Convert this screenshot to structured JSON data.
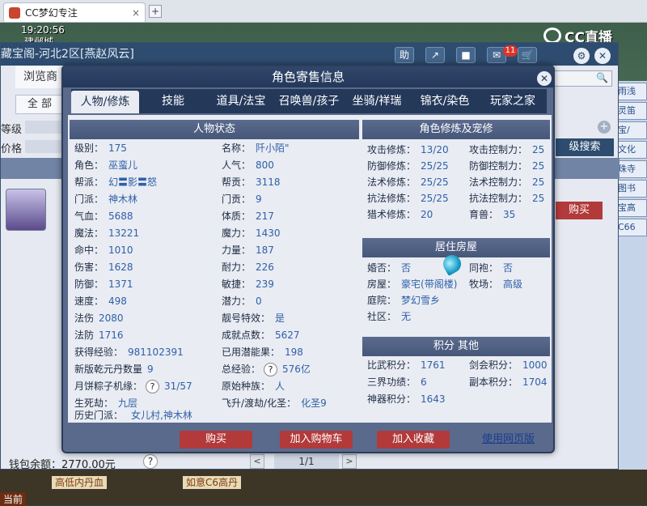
{
  "browser": {
    "tab_title": "CC梦幻专注",
    "close_glyph": "×",
    "new_tab_glyph": "+"
  },
  "hud": {
    "time": "19:20:56",
    "location": "建邺城",
    "cc_brand": "CC直播"
  },
  "back_window": {
    "title": "藏宝阁-河北2区[燕赵风云]",
    "toolbar": {
      "help": "助",
      "share_icon": "share-icon",
      "stop": "■",
      "message_badge": "11",
      "cart_icon": "cart-icon",
      "settings": "⚙",
      "close": "✕"
    },
    "nav_browse": "浏览商",
    "all_filter": "全 部",
    "level_label": "等级",
    "price_label": "价格",
    "plus": "+",
    "advanced_search": "级搜索",
    "buy_small": "购买",
    "wallet_text": "钱包余额：2770.00元",
    "question": "?",
    "pager": {
      "prev": "<",
      "text": "1/1",
      "next": ">"
    }
  },
  "right_strip": [
    "雨浅",
    "灵笛",
    "宝/",
    "文化",
    "珠寺",
    "图书",
    "宝高",
    "C66"
  ],
  "bottom_strip": {
    "items": [
      "高低内丹血",
      "如意C6高丹"
    ],
    "current": "当前"
  },
  "modal": {
    "title": "角色寄售信息",
    "close": "✕",
    "tabs": [
      {
        "label": "人物/修炼",
        "active": true
      },
      {
        "label": "技能",
        "active": false
      },
      {
        "label": "道具/法宝",
        "active": false
      },
      {
        "label": "召唤兽/孩子",
        "active": false
      },
      {
        "label": "坐骑/祥瑞",
        "active": false
      },
      {
        "label": "锦衣/染色",
        "active": false
      },
      {
        "label": "玩家之家",
        "active": false
      }
    ],
    "char_status": {
      "title": "人物状态",
      "rows": [
        [
          {
            "k": "级别：",
            "v": "175"
          },
          {
            "k": "名称：",
            "v": "阡小陌\""
          }
        ],
        [
          {
            "k": "角色：",
            "v": "巫蛮儿"
          },
          {
            "k": "人气：",
            "v": "800"
          }
        ],
        [
          {
            "k": "帮派：",
            "v": "幻〓影〓怒"
          },
          {
            "k": "帮贡：",
            "v": "3118"
          }
        ],
        [
          {
            "k": "门派：",
            "v": "神木林"
          },
          {
            "k": "门贡：",
            "v": "9"
          }
        ],
        [
          {
            "k": "气血：",
            "v": "5688"
          },
          {
            "k": "体质：",
            "v": "217"
          }
        ],
        [
          {
            "k": "魔法：",
            "v": "13221"
          },
          {
            "k": "魔力：",
            "v": "1430"
          }
        ],
        [
          {
            "k": "命中：",
            "v": "1010"
          },
          {
            "k": "力量：",
            "v": "187"
          }
        ],
        [
          {
            "k": "伤害：",
            "v": "1628"
          },
          {
            "k": "耐力：",
            "v": "226"
          }
        ],
        [
          {
            "k": "防御：",
            "v": "1371"
          },
          {
            "k": "敏捷：",
            "v": "239"
          }
        ],
        [
          {
            "k": "速度：",
            "v": "498"
          },
          {
            "k": "潜力：",
            "v": "0"
          }
        ],
        [
          {
            "k": "法伤",
            "v": "2080"
          },
          {
            "k": "靓号特效：",
            "v": "是"
          }
        ],
        [
          {
            "k": "法防",
            "v": "1716"
          },
          {
            "k": "成就点数：",
            "v": "5627"
          }
        ],
        [
          {
            "k": "获得经验：",
            "v": "981102391"
          },
          {
            "k": "已用潜能果：",
            "v": "198"
          }
        ],
        [
          {
            "k": "新版乾元丹数量",
            "v": "9"
          },
          {
            "k": "总经验：",
            "v": "576亿"
          }
        ],
        [
          {
            "k": "月饼粽子机缘：",
            "v": "31/57"
          },
          {
            "k": "原始种族：",
            "v": "人"
          }
        ],
        [
          {
            "k": "生死劫：",
            "v": "九层"
          },
          {
            "k": "飞升/渡劫/化圣：",
            "v": "化圣9"
          }
        ]
      ],
      "history_label": "历史门派：",
      "history_value": "女儿村,神木林"
    },
    "cultivation": {
      "title": "角色修炼及宠修",
      "rows": [
        [
          {
            "k": "攻击修炼：",
            "v": "13/20"
          },
          {
            "k": "攻击控制力：",
            "v": "25"
          }
        ],
        [
          {
            "k": "防御修炼：",
            "v": "25/25"
          },
          {
            "k": "防御控制力：",
            "v": "25"
          }
        ],
        [
          {
            "k": "法术修炼：",
            "v": "25/25"
          },
          {
            "k": "法术控制力：",
            "v": "25"
          }
        ],
        [
          {
            "k": "抗法修炼：",
            "v": "25/25"
          },
          {
            "k": "抗法控制力：",
            "v": "25"
          }
        ],
        [
          {
            "k": "猎术修炼：",
            "v": "20"
          },
          {
            "k": "育兽：",
            "v": "35"
          }
        ]
      ]
    },
    "housing": {
      "title": "居住房屋",
      "rows": [
        [
          {
            "k": "婚否：",
            "v": "否"
          },
          {
            "k": "同袍：",
            "v": "否"
          }
        ],
        [
          {
            "k": "房屋：",
            "v": "豪宅(带阁楼)"
          },
          {
            "k": "牧场：",
            "v": "高级"
          }
        ],
        [
          {
            "k": "庭院：",
            "v": "梦幻雪乡"
          }
        ],
        [
          {
            "k": "社区：",
            "v": "无"
          }
        ]
      ]
    },
    "points": {
      "title": "积分 其他",
      "rows": [
        [
          {
            "k": "比武积分：",
            "v": "1761"
          },
          {
            "k": "剑会积分：",
            "v": "1000"
          }
        ],
        [
          {
            "k": "三界功绩：",
            "v": "6"
          },
          {
            "k": "副本积分：",
            "v": "1704"
          }
        ],
        [
          {
            "k": "神器积分：",
            "v": "1643"
          }
        ]
      ]
    },
    "question": "?",
    "buttons": {
      "buy": "购买",
      "add_cart": "加入购物车",
      "add_fav": "加入收藏",
      "web_version": "使用网页版"
    }
  }
}
